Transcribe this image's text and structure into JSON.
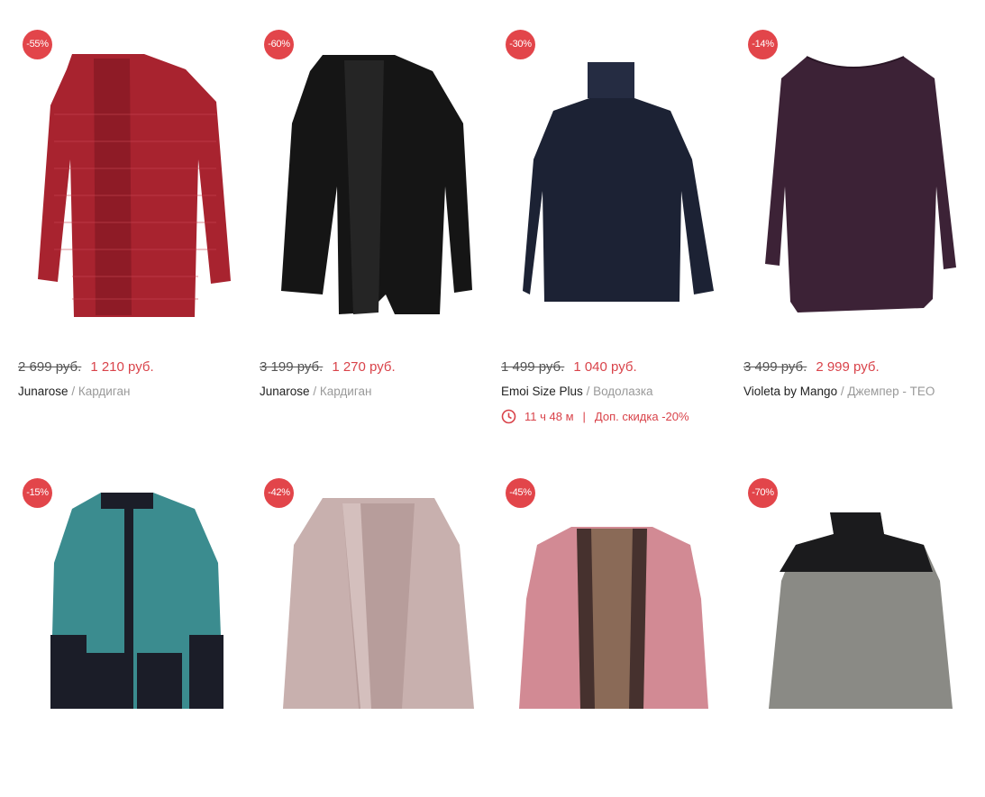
{
  "products": [
    {
      "discount": "-55%",
      "old_price": "2 699 руб.",
      "new_price": "1 210 руб.",
      "brand": "Junarose",
      "separator": "/",
      "category": "Кардиган",
      "image": "red-cardigan",
      "color": "#a8232f"
    },
    {
      "discount": "-60%",
      "old_price": "3 199 руб.",
      "new_price": "1 270 руб.",
      "brand": "Junarose",
      "separator": "/",
      "category": "Кардиган",
      "image": "black-cardigan",
      "color": "#151515"
    },
    {
      "discount": "-30%",
      "old_price": "1 499 руб.",
      "new_price": "1 040 руб.",
      "brand": "Emoi Size Plus",
      "separator": "/",
      "category": "Водолазка",
      "image": "navy-turtleneck",
      "color": "#1c2234",
      "timer": {
        "time": "11 ч 48 м",
        "pipe": "|",
        "extra_discount": "Доп. скидка -20%"
      }
    },
    {
      "discount": "-14%",
      "old_price": "3 499 руб.",
      "new_price": "2 999 руб.",
      "brand": "Violeta by Mango",
      "separator": "/",
      "category": "Джемпер - TEO",
      "image": "purple-jumper",
      "color": "#3c2236"
    },
    {
      "discount": "-15%",
      "image": "teal-cardigan",
      "color": "#3b8c8f"
    },
    {
      "discount": "-42%",
      "image": "pink-melange-cardigan",
      "color": "#c8b0ae"
    },
    {
      "discount": "-45%",
      "image": "pink-patterned-cardigan",
      "color": "#d28a94"
    },
    {
      "discount": "-70%",
      "image": "grey-turtleneck-sweater",
      "color": "#8a8a85"
    }
  ]
}
